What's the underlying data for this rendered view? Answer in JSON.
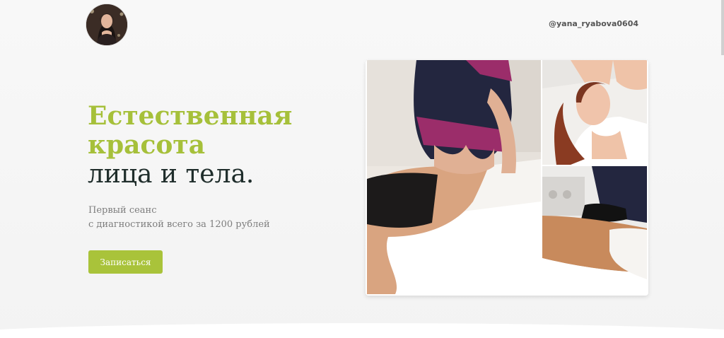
{
  "header": {
    "handle": "@yana_ryabova0604"
  },
  "hero": {
    "title_line1": "Естественная",
    "title_line2": "красота",
    "title_line3": "лица и тела.",
    "subtitle_line1": "Первый сеанс",
    "subtitle_line2": "с диагностикой всего за 1200 рублей",
    "cta_label": "Записаться"
  },
  "colors": {
    "accent": "#a6c03a",
    "dark_text": "#1f2d2b",
    "muted_text": "#7d7d7d",
    "button_bg": "#a9c33a"
  },
  "icons": {
    "avatar": "profile-photo"
  }
}
